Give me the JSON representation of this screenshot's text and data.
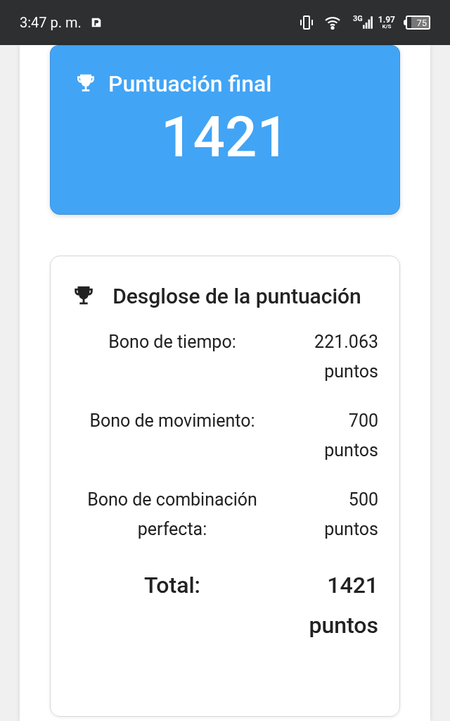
{
  "status_bar": {
    "time": "3:47 p. m.",
    "network": "3G",
    "speed": "1.97",
    "speed_unit": "K/S",
    "battery": "75"
  },
  "final_score": {
    "title": "Puntuación final",
    "value": "1421"
  },
  "breakdown": {
    "title": "Desglose de la puntuación",
    "rows": [
      {
        "kind": "item",
        "label": "Bono de tiempo:",
        "value": "221.063 puntos"
      },
      {
        "kind": "item",
        "label": "Bono de movimiento:",
        "value": "700 puntos"
      },
      {
        "kind": "item",
        "label": "Bono de combinación perfecta:",
        "value": "500 puntos"
      },
      {
        "kind": "total",
        "label": "Total:",
        "value": "1421 puntos"
      }
    ]
  }
}
